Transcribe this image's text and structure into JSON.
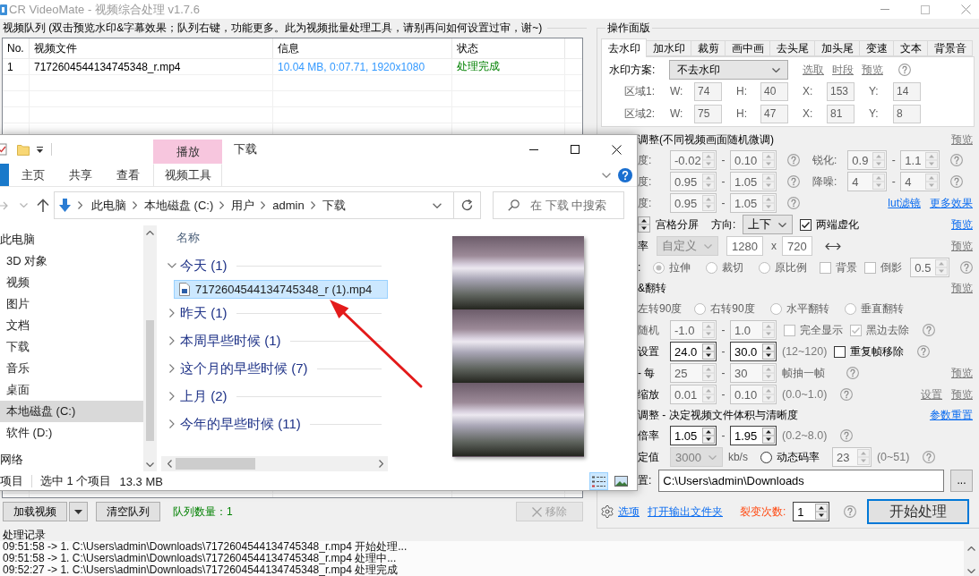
{
  "window": {
    "title": "CR VideoMate - 视频综合处理 v1.7.6"
  },
  "queue": {
    "title": "视频队列 (双击预览水印&字幕效果；队列右键，功能更多。此为视频批量处理工具，请别再问如何设置过审，谢~)",
    "columns": [
      "No.",
      "视频文件",
      "信息",
      "状态"
    ],
    "rows": [
      {
        "cells": [
          "1",
          "7172604544134745348_r.mp4",
          "10.04 MB, 0:07.71, 1920x1080",
          "处理完成"
        ]
      }
    ],
    "buttons": [
      {
        "label": "加载视频",
        "kind": "split",
        "disabled": false
      },
      {
        "label": "清空队列",
        "kind": "plain",
        "disabled": false
      }
    ],
    "count": "队列数量：1",
    "remove": {
      "label": "移除",
      "disabled": true
    }
  },
  "panel": {
    "title": "操作面版",
    "tabs": [
      {
        "label": "去水印",
        "selected": true
      },
      {
        "label": "加水印",
        "selected": false
      },
      {
        "label": "裁剪",
        "selected": false
      },
      {
        "label": "画中画",
        "selected": false
      },
      {
        "label": "去头尾",
        "selected": false
      },
      {
        "label": "加头尾",
        "selected": false
      },
      {
        "label": "变速",
        "selected": false
      },
      {
        "label": "文本",
        "selected": false
      },
      {
        "label": "背景音",
        "selected": false
      }
    ],
    "scheme": {
      "label": "水印方案:",
      "value": "不去水印",
      "links": [
        {
          "text": "选取",
          "disabled": true
        },
        {
          "text": "时段",
          "disabled": true
        },
        {
          "text": "预览",
          "disabled": true
        }
      ]
    },
    "regions": [
      {
        "label": "区域1:",
        "disabled": true,
        "fields": [
          {
            "axis": "W:",
            "value": "74"
          },
          {
            "axis": "H:",
            "value": "40"
          },
          {
            "axis": "X:",
            "value": "153"
          },
          {
            "axis": "Y:",
            "value": "14"
          }
        ]
      },
      {
        "label": "区域2:",
        "disabled": true,
        "fields": [
          {
            "axis": "W:",
            "value": "75"
          },
          {
            "axis": "H:",
            "value": "47"
          },
          {
            "axis": "X:",
            "value": "81"
          },
          {
            "axis": "Y:",
            "value": "8"
          }
        ]
      }
    ],
    "rows": [
      {
        "items": [
          {
            "kind": "heading",
            "text": "调整(不同视频画面随机微调)"
          }
        ],
        "links": [
          {
            "text": "预览",
            "disabled": true
          }
        ]
      },
      {
        "items": [
          {
            "kind": "lead",
            "text": "度:",
            "disabled": true
          },
          {
            "kind": "spin",
            "value": "-0.02",
            "disabled": true
          },
          {
            "kind": "dash",
            "text": "-"
          },
          {
            "kind": "spin",
            "value": "0.10",
            "disabled": true
          },
          {
            "kind": "help"
          },
          {
            "kind": "label",
            "text": "锐化:",
            "disabled": true
          },
          {
            "kind": "spin",
            "value": "0.9",
            "disabled": true
          },
          {
            "kind": "dash",
            "text": "-"
          },
          {
            "kind": "spin",
            "value": "1.1",
            "disabled": true
          },
          {
            "kind": "help"
          }
        ]
      },
      {
        "items": [
          {
            "kind": "lead",
            "text": "度:",
            "disabled": true
          },
          {
            "kind": "spin",
            "value": "0.95",
            "disabled": true
          },
          {
            "kind": "dash",
            "text": "-"
          },
          {
            "kind": "spin",
            "value": "1.05",
            "disabled": true
          },
          {
            "kind": "help"
          },
          {
            "kind": "label",
            "text": "降噪:",
            "disabled": true
          },
          {
            "kind": "spin",
            "value": "4",
            "disabled": true
          },
          {
            "kind": "dash",
            "text": "-"
          },
          {
            "kind": "spin",
            "value": "4",
            "disabled": true
          },
          {
            "kind": "help"
          }
        ]
      },
      {
        "items": [
          {
            "kind": "lead",
            "text": "度:",
            "disabled": true
          },
          {
            "kind": "spin",
            "value": "0.95",
            "disabled": true
          },
          {
            "kind": "dash",
            "text": "-"
          },
          {
            "kind": "spin",
            "value": "1.05",
            "disabled": true
          },
          {
            "kind": "help"
          }
        ],
        "links": [
          {
            "text": "lut滤镜",
            "disabled": false
          },
          {
            "text": "更多效果",
            "disabled": false
          }
        ]
      },
      {
        "items": [
          {
            "kind": "stepper"
          },
          {
            "kind": "text",
            "text": "宫格分屏",
            "disabled": false
          },
          {
            "kind": "label",
            "text": "方向:",
            "disabled": false
          },
          {
            "kind": "select",
            "value": "上下",
            "disabled": false
          },
          {
            "kind": "check",
            "text": "两端虚化",
            "checked": true,
            "disabled": false
          }
        ],
        "links": [
          {
            "text": "预览",
            "disabled": false
          }
        ]
      },
      {
        "items": [
          {
            "kind": "text",
            "text": "率",
            "disabled": false
          },
          {
            "kind": "select",
            "value": "自定义",
            "disabled": true
          },
          {
            "kind": "input",
            "value": "1280",
            "disabled": true
          },
          {
            "kind": "text",
            "text": "x",
            "disabled": true
          },
          {
            "kind": "input",
            "value": "720",
            "disabled": true
          },
          {
            "kind": "swap"
          }
        ],
        "links": [
          {
            "text": "预览",
            "disabled": true
          }
        ]
      },
      {
        "items": [
          {
            "kind": "text",
            "text": ":",
            "disabled": false
          },
          {
            "kind": "radio",
            "text": "拉伸",
            "selected": true,
            "disabled": true
          },
          {
            "kind": "radio",
            "text": "裁切",
            "selected": false,
            "disabled": true
          },
          {
            "kind": "radio",
            "text": "原比例",
            "selected": false,
            "disabled": true
          },
          {
            "kind": "check",
            "text": "背景",
            "checked": false,
            "disabled": true
          },
          {
            "kind": "check",
            "text": "倒影",
            "checked": false,
            "disabled": true
          },
          {
            "kind": "spin",
            "value": "0.5",
            "disabled": true
          },
          {
            "kind": "help"
          }
        ]
      },
      {
        "items": [
          {
            "kind": "heading",
            "text": "&翻转"
          }
        ],
        "links": [
          {
            "text": "预览",
            "disabled": true
          }
        ]
      },
      {
        "items": [
          {
            "kind": "text",
            "text": "左转90度",
            "disabled": true
          },
          {
            "kind": "radio",
            "text": "右转90度",
            "selected": false,
            "disabled": true
          },
          {
            "kind": "radio",
            "text": "水平翻转",
            "selected": false,
            "disabled": true
          },
          {
            "kind": "radio",
            "text": "垂直翻转",
            "selected": false,
            "disabled": true
          }
        ]
      },
      {
        "items": [
          {
            "kind": "lead",
            "text": "随机",
            "disabled": true
          },
          {
            "kind": "spin",
            "value": "-1.0",
            "disabled": true
          },
          {
            "kind": "dash",
            "text": "-"
          },
          {
            "kind": "spin",
            "value": "1.0",
            "disabled": true
          },
          {
            "kind": "check",
            "text": "完全显示",
            "checked": false,
            "disabled": true
          },
          {
            "kind": "check",
            "text": "黑边去除",
            "checked": true,
            "disabled": true
          },
          {
            "kind": "help"
          }
        ]
      },
      {
        "items": [
          {
            "kind": "lead",
            "text": "设置",
            "disabled": false
          },
          {
            "kind": "spin",
            "value": "24.0",
            "disabled": false
          },
          {
            "kind": "dash",
            "text": "-"
          },
          {
            "kind": "spin",
            "value": "30.0",
            "disabled": false
          },
          {
            "kind": "note",
            "text": "(12~120)"
          },
          {
            "kind": "check",
            "text": "重复帧移除",
            "checked": false,
            "disabled": false
          },
          {
            "kind": "help"
          }
        ]
      },
      {
        "items": [
          {
            "kind": "lead",
            "text": "- 每",
            "disabled": false
          },
          {
            "kind": "spin",
            "value": "25",
            "disabled": true
          },
          {
            "kind": "dash",
            "text": "-"
          },
          {
            "kind": "spin",
            "value": "30",
            "disabled": true
          },
          {
            "kind": "text",
            "text": "帧抽一帧",
            "disabled": true
          },
          {
            "kind": "help"
          }
        ],
        "links": [
          {
            "text": "预览",
            "disabled": true
          }
        ]
      },
      {
        "items": [
          {
            "kind": "lead",
            "text": "缩放",
            "disabled": false
          },
          {
            "kind": "spin",
            "value": "0.01",
            "disabled": true
          },
          {
            "kind": "dash",
            "text": "-"
          },
          {
            "kind": "spin",
            "value": "0.10",
            "disabled": true
          },
          {
            "kind": "note",
            "text": "(0.0~1.0)"
          },
          {
            "kind": "help"
          }
        ],
        "links": [
          {
            "text": "设置",
            "disabled": true
          },
          {
            "text": "预览",
            "disabled": true
          }
        ]
      },
      {
        "items": [
          {
            "kind": "heading",
            "text": "调整 - 决定视频文件体积与清晰度"
          }
        ],
        "links": [
          {
            "text": "参数重置",
            "disabled": false
          }
        ]
      },
      {
        "items": [
          {
            "kind": "lead",
            "text": "倍率",
            "disabled": false
          },
          {
            "kind": "spin",
            "value": "1.05",
            "disabled": false
          },
          {
            "kind": "dash",
            "text": "-"
          },
          {
            "kind": "spin",
            "value": "1.95",
            "disabled": false
          },
          {
            "kind": "note",
            "text": "(0.2~8.0)"
          },
          {
            "kind": "help"
          }
        ]
      },
      {
        "items": [
          {
            "kind": "lead",
            "text": "定值",
            "disabled": false
          },
          {
            "kind": "select",
            "value": "3000",
            "disabled": true
          },
          {
            "kind": "text",
            "text": "kb/s",
            "disabled": true
          },
          {
            "kind": "radio",
            "text": "动态码率",
            "selected": false,
            "disabled": false
          },
          {
            "kind": "spin",
            "value": "23",
            "disabled": true
          },
          {
            "kind": "note",
            "text": "(0~51)"
          },
          {
            "kind": "help"
          }
        ]
      },
      {
        "items": [
          {
            "kind": "text",
            "text": "置:",
            "disabled": false
          },
          {
            "kind": "path",
            "value": "C:\\Users\\admin\\Downloads"
          },
          {
            "kind": "button",
            "text": "..."
          }
        ]
      }
    ],
    "footer": {
      "links": [
        {
          "text": "选项",
          "disabled": false
        },
        {
          "text": "打开输出文件夹",
          "disabled": false
        }
      ],
      "label": "裂变次数:",
      "spin": {
        "value": "1",
        "disabled": false
      },
      "start": {
        "label": "开始处理",
        "focused": true
      }
    }
  },
  "log": {
    "title": "处理记录",
    "lines": [
      "09:51:58 -> 1. C:\\Users\\admin\\Downloads\\7172604544134745348_r.mp4 开始处理...",
      "09:51:58 -> 1. C:\\Users\\admin\\Downloads\\7172604544134745348_r.mp4 处理中...",
      "09:52:27 -> 1. C:\\Users\\admin\\Downloads\\7172604544134745348_r.mp4 处理完成"
    ]
  },
  "explorer": {
    "title": "下载",
    "context_group": "播放",
    "tabs": [
      {
        "label": "主页",
        "kind": "normal",
        "selected": false
      },
      {
        "label": "共享",
        "kind": "normal",
        "selected": false
      },
      {
        "label": "查看",
        "kind": "normal",
        "selected": false
      },
      {
        "label": "视频工具",
        "kind": "context",
        "selected": false
      }
    ],
    "path": [
      "此电脑",
      "本地磁盘 (C:)",
      "用户",
      "admin",
      "下载"
    ],
    "search": {
      "placeholder": "在 下载 中搜索"
    },
    "nav": [
      {
        "label": "此电脑",
        "selected": false,
        "children": [
          {
            "label": "3D 对象",
            "selected": false
          },
          {
            "label": "视频",
            "selected": false
          },
          {
            "label": "图片",
            "selected": false
          },
          {
            "label": "文档",
            "selected": false
          },
          {
            "label": "下载",
            "selected": false
          },
          {
            "label": "音乐",
            "selected": false
          },
          {
            "label": "桌面",
            "selected": false
          },
          {
            "label": "本地磁盘 (C:)",
            "selected": true
          },
          {
            "label": "软件 (D:)",
            "selected": false
          }
        ]
      },
      {
        "label": "网络",
        "selected": false
      }
    ],
    "column": "名称",
    "groups": [
      {
        "label": "今天 (1)",
        "expanded": true,
        "files": [
          {
            "name": "7172604544134745348_r (1).mp4",
            "selected": true
          }
        ]
      },
      {
        "label": "昨天 (1)",
        "expanded": false
      },
      {
        "label": "本周早些时候 (1)",
        "expanded": false
      },
      {
        "label": "这个月的早些时候 (7)",
        "expanded": false
      },
      {
        "label": "上月 (2)",
        "expanded": false
      },
      {
        "label": "今年的早些时候 (11)",
        "expanded": false
      }
    ],
    "status": [
      "项目",
      "选中 1 个项目",
      "13.3 MB"
    ],
    "views": [
      {
        "kind": "details",
        "selected": true
      },
      {
        "kind": "preview",
        "selected": false
      }
    ]
  }
}
